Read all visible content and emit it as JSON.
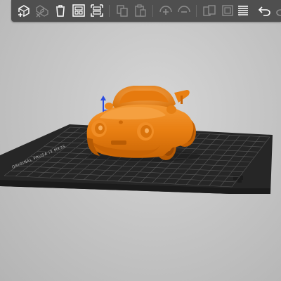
{
  "app": {
    "view": "3D preparation view"
  },
  "toolbar": {
    "items": [
      {
        "name": "add-model-button",
        "icon": "add-cube-icon",
        "enabled": true
      },
      {
        "name": "delete-button",
        "icon": "delete-cubes-icon",
        "enabled": false
      },
      {
        "name": "delete-all-button",
        "icon": "trash-icon",
        "enabled": true
      },
      {
        "name": "arrange-button",
        "icon": "arrange-icon",
        "enabled": true
      },
      {
        "name": "split-layout-button",
        "icon": "layout-split-icon",
        "enabled": true
      },
      {
        "name": "copy-button",
        "icon": "copy-icon",
        "enabled": false
      },
      {
        "name": "paste-button",
        "icon": "paste-icon",
        "enabled": false
      },
      {
        "name": "add-instance-button",
        "icon": "add-instance-icon",
        "enabled": false
      },
      {
        "name": "remove-instance-button",
        "icon": "remove-instance-icon",
        "enabled": false
      },
      {
        "name": "split-to-objects-button",
        "icon": "split-objects-icon",
        "enabled": false
      },
      {
        "name": "split-to-parts-button",
        "icon": "split-parts-icon",
        "enabled": false
      },
      {
        "name": "variable-layer-height-button",
        "icon": "layers-icon",
        "enabled": true
      },
      {
        "name": "undo-button",
        "icon": "undo-icon",
        "enabled": true
      },
      {
        "name": "redo-button",
        "icon": "redo-icon",
        "enabled": false
      }
    ]
  },
  "bed": {
    "label": "ORIGINAL PRUSA i3 MK3S",
    "plate_color": "#2a2a2a",
    "grid_color": "#5a5a5a"
  },
  "model": {
    "name": "car-model",
    "color": "#f28a1c"
  },
  "colors": {
    "toolbar_bg": "#4f4f4f",
    "icon": "#ffffff",
    "accent": "#f28a1c",
    "axis_z": "#2a4be0"
  }
}
